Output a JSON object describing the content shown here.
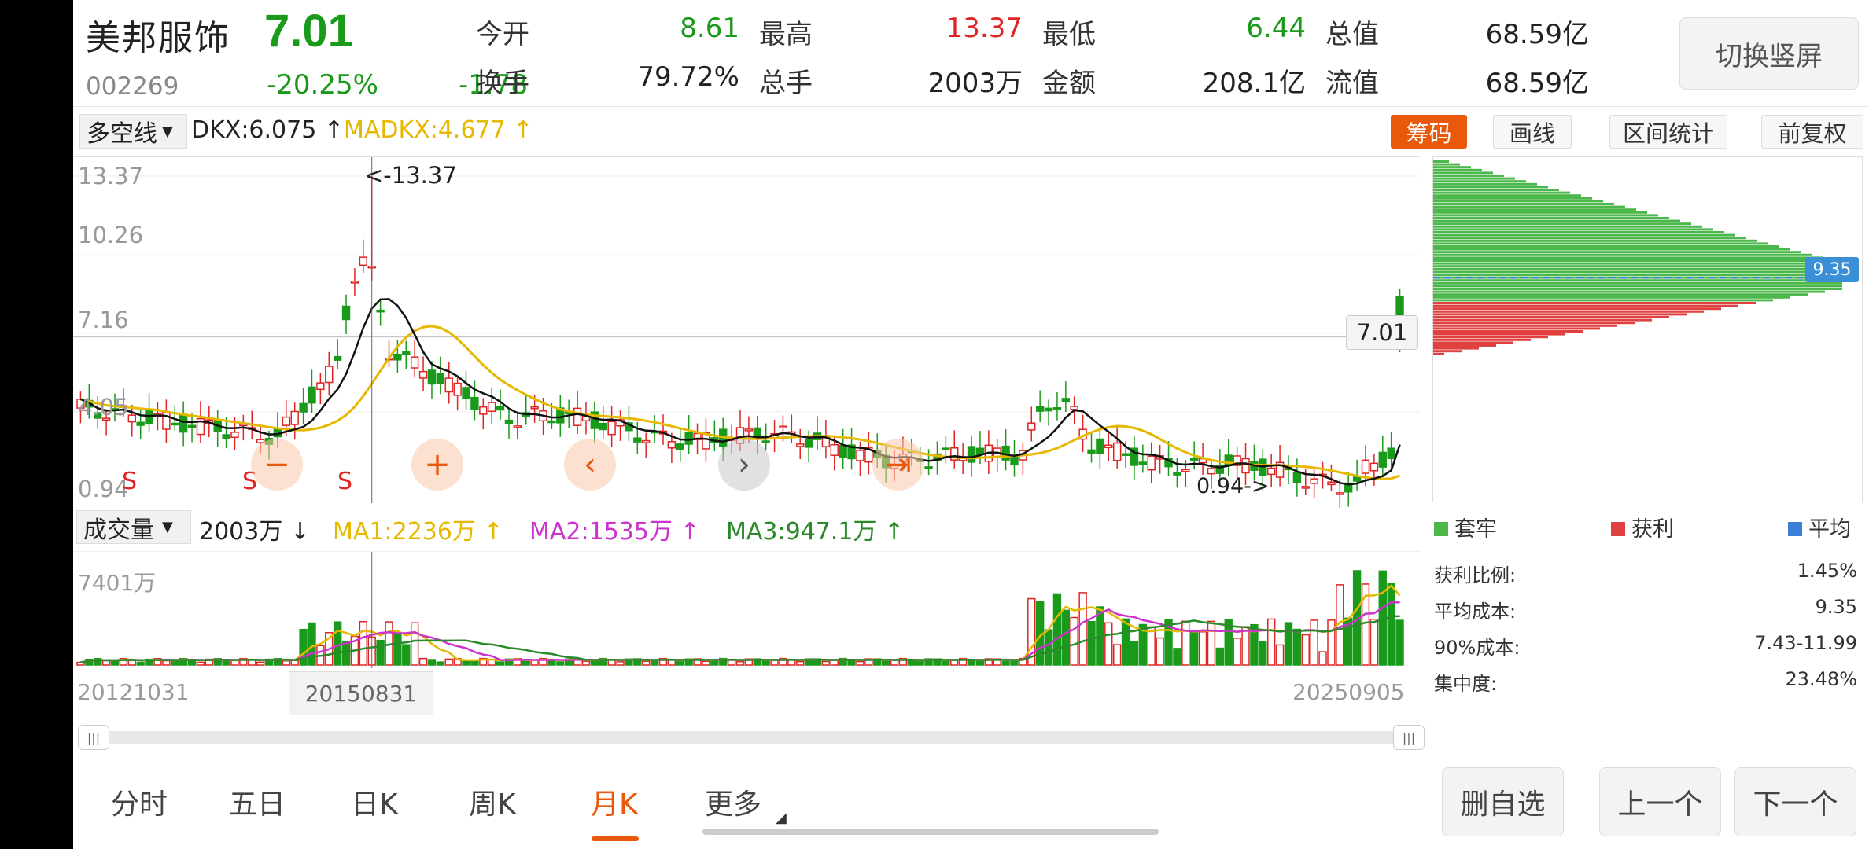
{
  "header": {
    "name": "美邦服饰",
    "price": "7.01",
    "code": "002269",
    "change_pct": "-20.25%",
    "change": "-1.78",
    "switch_button": "切换竖屏",
    "stats": [
      {
        "label": "今开",
        "value": "8.61",
        "color": "green"
      },
      {
        "label": "最高",
        "value": "13.37",
        "color": "red"
      },
      {
        "label": "最低",
        "value": "6.44",
        "color": "green"
      },
      {
        "label": "总值",
        "value": "68.59亿",
        "color": "plain"
      },
      {
        "label": "换手",
        "value": "79.72%",
        "color": "plain"
      },
      {
        "label": "总手",
        "value": "2003万",
        "color": "plain"
      },
      {
        "label": "金额",
        "value": "208.1亿",
        "color": "plain"
      },
      {
        "label": "流值",
        "value": "68.59亿",
        "color": "plain"
      }
    ]
  },
  "toolbar": {
    "indicator_select": "多空线",
    "dkx": "DKX:6.075",
    "madkx": "MADKX:4.677",
    "buttons": [
      "筹码",
      "画线",
      "区间统计",
      "前复权"
    ]
  },
  "price_chart": {
    "y_ticks": [
      "13.37",
      "10.26",
      "7.16",
      "4.05",
      "0.94"
    ],
    "max_label": "<-13.37",
    "min_label": "0.94->",
    "current": "7.01",
    "signals": [
      "S",
      "S",
      "S"
    ]
  },
  "volume_bar": {
    "select": "成交量",
    "vol": "2003万",
    "ma1": "MA1:2236万",
    "ma2": "MA2:1535万",
    "ma3": "MA3:947.1万",
    "y_max": "7401万"
  },
  "dates": {
    "start": "20121031",
    "cursor": "20150831",
    "end": "20250905"
  },
  "chips": {
    "avg_cost_marker": "9.35",
    "legend": [
      "套牢",
      "获利",
      "平均"
    ],
    "stats": [
      {
        "label": "获利比例:",
        "value": "1.45%"
      },
      {
        "label": "平均成本:",
        "value": "9.35"
      },
      {
        "label": "90%成本:",
        "value": "7.43-11.99"
      },
      {
        "label": "集中度:",
        "value": "23.48%"
      }
    ]
  },
  "tabs": [
    {
      "label": "分时",
      "active": false
    },
    {
      "label": "五日",
      "active": false
    },
    {
      "label": "日K",
      "active": false
    },
    {
      "label": "周K",
      "active": false
    },
    {
      "label": "月K",
      "active": true
    },
    {
      "label": "更多",
      "active": false
    }
  ],
  "nav_buttons": [
    "删自选",
    "上一个",
    "下一个"
  ],
  "chart_data": {
    "type": "candlestick",
    "period": "monthly",
    "y_range": [
      0.94,
      13.37
    ],
    "max": 13.37,
    "min": 0.94,
    "last_close": 7.01,
    "dkx_last": 6.075,
    "madkx_last": 4.677,
    "avg_cost": 9.35,
    "profit_ratio_pct": 1.45,
    "vol_max_wan": 7401,
    "x_range": [
      "20121031",
      "20250905"
    ]
  },
  "colors": {
    "up": "#e02424",
    "down": "#1a9a1a",
    "accent": "#e8590c",
    "dkx": "#111111",
    "madkx": "#e6b800",
    "ma2": "#cc33cc",
    "ma3": "#2a8a2a"
  }
}
